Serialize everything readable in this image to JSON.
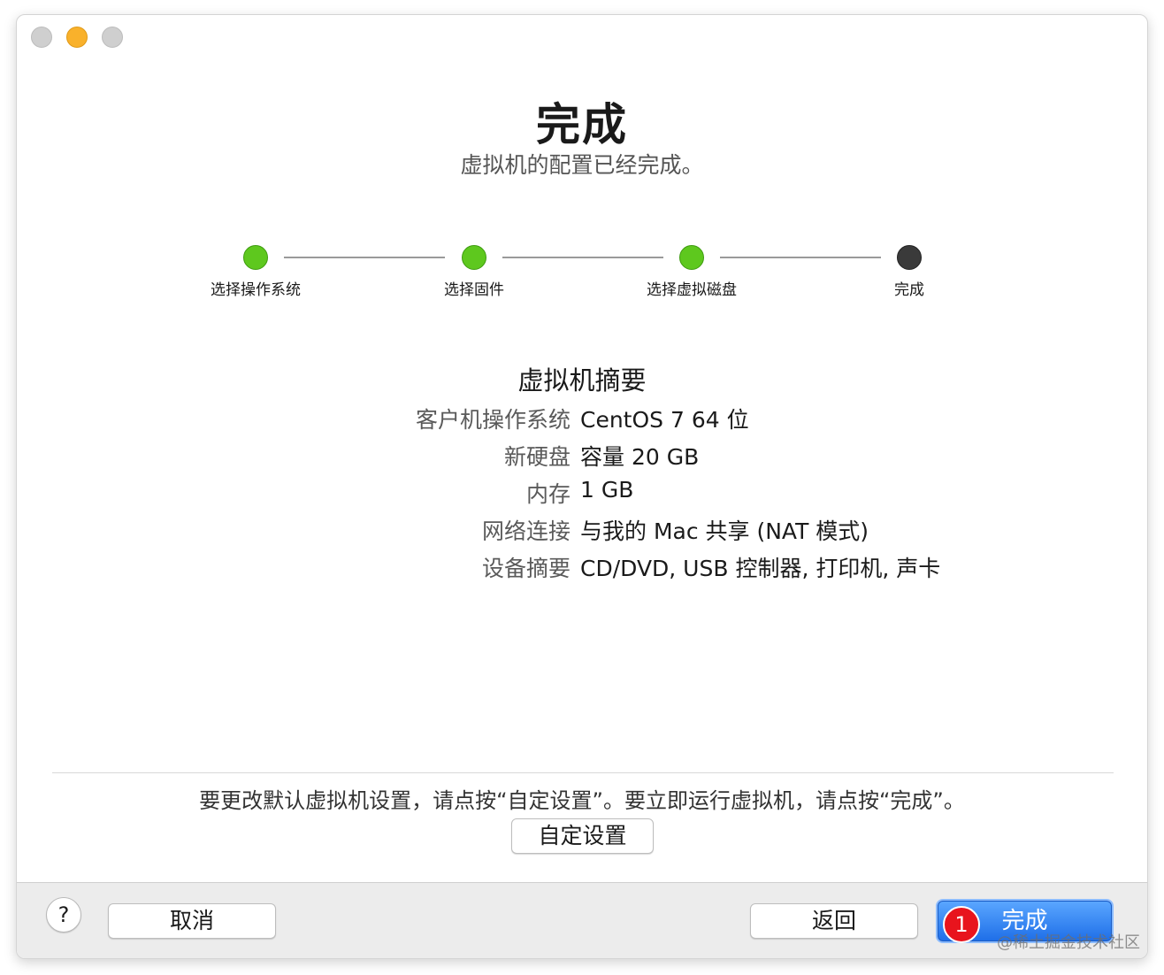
{
  "header": {
    "title": "完成",
    "subtitle": "虚拟机的配置已经完成。"
  },
  "steps": [
    {
      "label": "选择操作系统",
      "state": "done"
    },
    {
      "label": "选择固件",
      "state": "done"
    },
    {
      "label": "选择虚拟磁盘",
      "state": "done"
    },
    {
      "label": "完成",
      "state": "current"
    }
  ],
  "summary": {
    "title": "虚拟机摘要",
    "rows": [
      {
        "key": "客户机操作系统",
        "value": "CentOS 7 64 位"
      },
      {
        "key": "新硬盘",
        "value": "容量 20 GB"
      },
      {
        "key": "内存",
        "value": "1 GB"
      },
      {
        "key": "网络连接",
        "value": "与我的 Mac 共享 (NAT 模式)"
      },
      {
        "key": "设备摘要",
        "value": "CD/DVD, USB 控制器, 打印机, 声卡"
      }
    ]
  },
  "hint": "要更改默认虚拟机设置，请点按“自定设置”。要立即运行虚拟机，请点按“完成”。",
  "buttons": {
    "customize": "自定设置",
    "help": "?",
    "cancel": "取消",
    "back": "返回",
    "finish": "完成"
  },
  "badge": "1",
  "watermark": "@稀土掘金技术社区",
  "colors": {
    "step_done": "#5ec81e",
    "step_current": "#3a3a3a",
    "primary_button": "#2f80f0",
    "badge": "#e8141d",
    "traffic_minimize": "#f9b12b",
    "traffic_inactive": "#cfcfcf"
  }
}
